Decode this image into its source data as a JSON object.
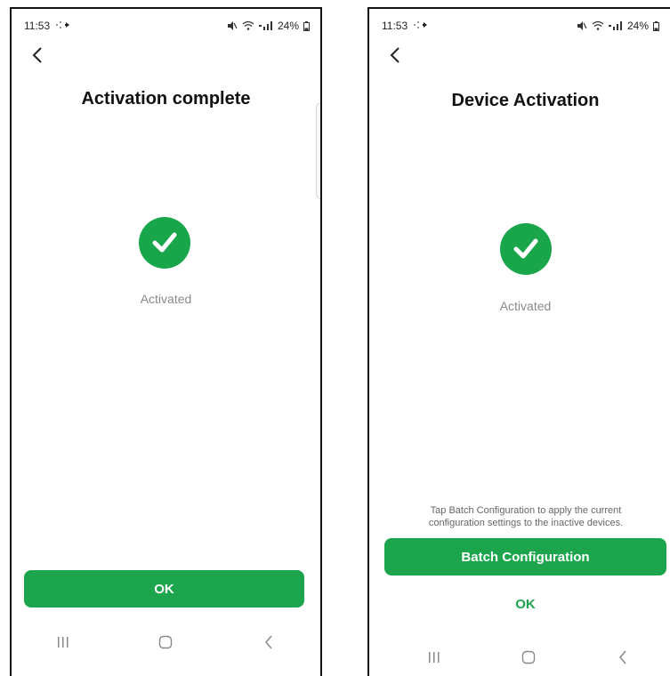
{
  "left": {
    "status": {
      "time": "11:53",
      "battery": "24%"
    },
    "title": "Activation complete",
    "status_text": "Activated",
    "ok_label": "OK"
  },
  "right": {
    "status": {
      "time": "11:53",
      "battery": "24%"
    },
    "title": "Device Activation",
    "status_text": "Activated",
    "hint_line1": "Tap Batch Configuration to apply the current",
    "hint_line2": "configuration settings to the inactive devices.",
    "batch_label": "Batch Configuration",
    "ok_label": "OK"
  },
  "colors": {
    "accent": "#1ca54c",
    "check_green": "#19a64a",
    "muted": "#8a8a8a"
  },
  "icons": {
    "status": [
      "cast-icon",
      "mute-icon",
      "wifi-icon",
      "signal-icon",
      "battery-icon"
    ],
    "nav": [
      "recent-apps-icon",
      "home-icon",
      "back-nav-icon"
    ],
    "back": "back-arrow-icon",
    "check": "checkmark-icon"
  }
}
